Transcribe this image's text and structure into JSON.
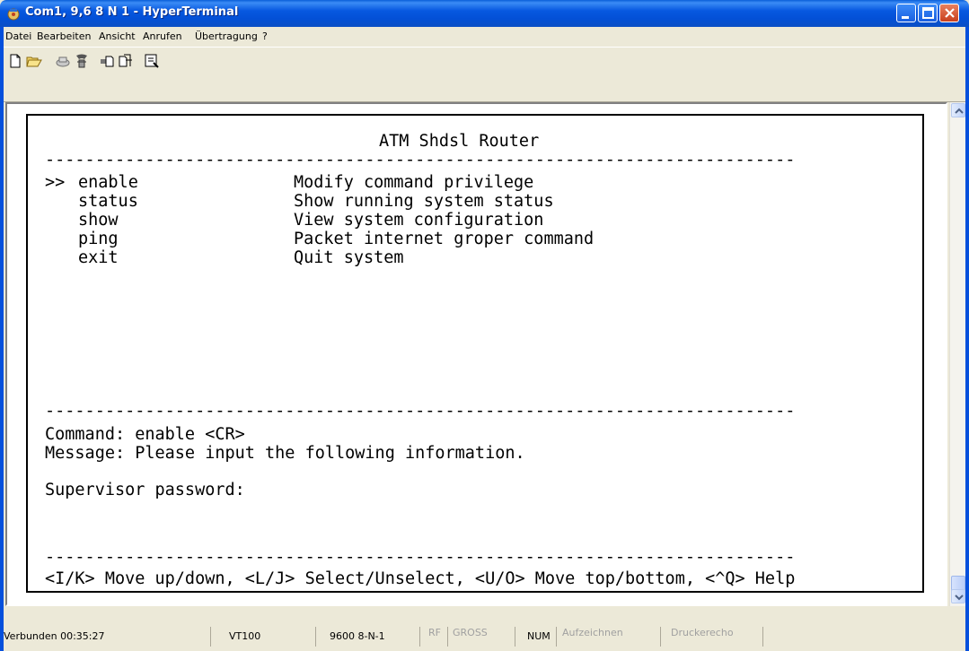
{
  "window": {
    "title": "Com1, 9,6 8 N 1 - HyperTerminal"
  },
  "menu": [
    {
      "label": "Datei"
    },
    {
      "label": "Bearbeiten"
    },
    {
      "label": "Ansicht"
    },
    {
      "label": "Anrufen"
    },
    {
      "label": "Übertragung"
    },
    {
      "label": "?"
    }
  ],
  "toolbar": {
    "icons": [
      "new-icon",
      "open-icon",
      "connect-icon",
      "disconnect-icon",
      "send-icon",
      "receive-icon",
      "properties-icon"
    ]
  },
  "terminal": {
    "header": "ATM Shdsl Router",
    "separator": "---------------------------------------------------------------------------",
    "selector": ">>",
    "commands": [
      {
        "name": "enable",
        "desc": "Modify command privilege"
      },
      {
        "name": "status",
        "desc": "Show running system status"
      },
      {
        "name": "show",
        "desc": "View system configuration"
      },
      {
        "name": "ping",
        "desc": "Packet internet groper command"
      },
      {
        "name": "exit",
        "desc": "Quit system"
      }
    ],
    "command_line": "Command: enable <CR>",
    "message_line": "Message: Please input the following information.",
    "prompt": "Supervisor password:",
    "help_line": "<I/K> Move up/down, <L/J> Select/Unselect, <U/O> Move top/bottom, <^Q> Help"
  },
  "status": {
    "connected": "Verbunden 00:35:27",
    "emulation": "VT100",
    "port_settings": "9600 8-N-1",
    "rf": "RF",
    "gross": "GROSS",
    "num": "NUM",
    "record": "Aufzeichnen",
    "print_echo": "Druckerecho"
  },
  "colors": {
    "titlebar": "#0550DC",
    "window_bg": "#ECE9D8",
    "terminal_bg": "#FFFFFF",
    "terminal_text": "#000000"
  }
}
